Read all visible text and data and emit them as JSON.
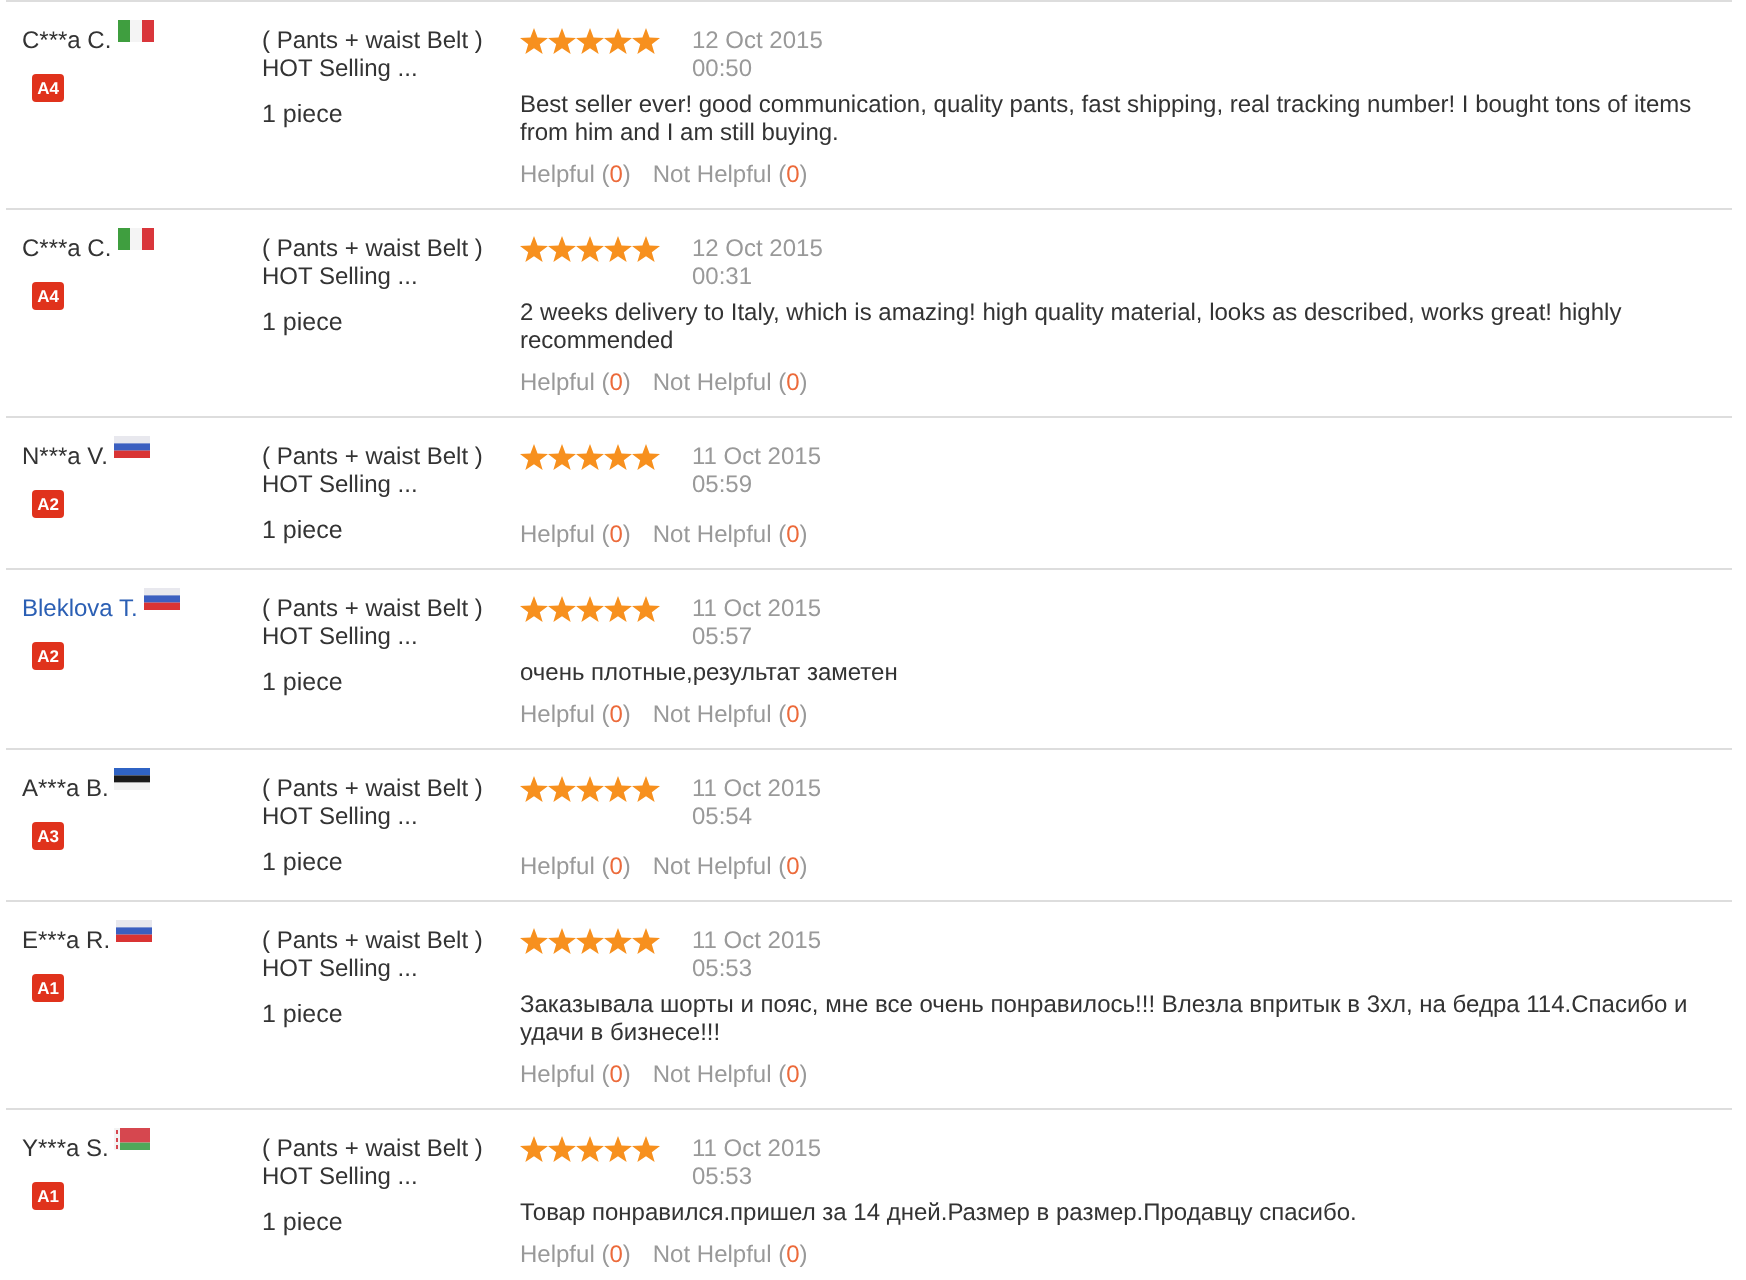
{
  "reviews": [
    {
      "reviewer": {
        "name": "C***a C.",
        "linked": false
      },
      "flag": {
        "kind": "italy"
      },
      "badge": "A4",
      "product": "( Pants + waist Belt ) HOT Selling ...",
      "quantity": "1 piece",
      "stars": 5,
      "date": "12 Oct 2015",
      "time": "00:50",
      "comment": "Best seller ever! good communication, quality pants, fast shipping, real tracking number! I bought tons of items from him and I am still buying.",
      "helpful": {
        "label": "Helpful",
        "open": "(",
        "count": "0",
        "close": ")"
      },
      "not_helpful": {
        "label": "Not Helpful",
        "open": "(",
        "count": "0",
        "close": ")"
      }
    },
    {
      "reviewer": {
        "name": "C***a C.",
        "linked": false
      },
      "flag": {
        "kind": "italy"
      },
      "badge": "A4",
      "product": "( Pants + waist Belt ) HOT Selling ...",
      "quantity": "1 piece",
      "stars": 5,
      "date": "12 Oct 2015",
      "time": "00:31",
      "comment": "2 weeks delivery to Italy, which is amazing! high quality material, looks as described, works great! highly recommended",
      "helpful": {
        "label": "Helpful",
        "open": "(",
        "count": "0",
        "close": ")"
      },
      "not_helpful": {
        "label": "Not Helpful",
        "open": "(",
        "count": "0",
        "close": ")"
      }
    },
    {
      "reviewer": {
        "name": "N***a V.",
        "linked": false
      },
      "flag": {
        "kind": "russia"
      },
      "badge": "A2",
      "product": "( Pants + waist Belt ) HOT Selling ...",
      "quantity": "1 piece",
      "stars": 5,
      "date": "11 Oct 2015",
      "time": "05:59",
      "helpful": {
        "label": "Helpful",
        "open": "(",
        "count": "0",
        "close": ")"
      },
      "not_helpful": {
        "label": "Not Helpful",
        "open": "(",
        "count": "0",
        "close": ")"
      }
    },
    {
      "reviewer": {
        "name": "Bleklova T.",
        "linked": true
      },
      "flag": {
        "kind": "russia"
      },
      "badge": "A2",
      "product": "( Pants + waist Belt ) HOT Selling ...",
      "quantity": "1 piece",
      "stars": 5,
      "date": "11 Oct 2015",
      "time": "05:57",
      "comment": "очень плотные,результат заметен",
      "helpful": {
        "label": "Helpful",
        "open": "(",
        "count": "0",
        "close": ")"
      },
      "not_helpful": {
        "label": "Not Helpful",
        "open": "(",
        "count": "0",
        "close": ")"
      }
    },
    {
      "reviewer": {
        "name": "A***a B.",
        "linked": false
      },
      "flag": {
        "kind": "estonia"
      },
      "badge": "A3",
      "product": "( Pants + waist Belt ) HOT Selling ...",
      "quantity": "1 piece",
      "stars": 5,
      "date": "11 Oct 2015",
      "time": "05:54",
      "helpful": {
        "label": "Helpful",
        "open": "(",
        "count": "0",
        "close": ")"
      },
      "not_helpful": {
        "label": "Not Helpful",
        "open": "(",
        "count": "0",
        "close": ")"
      }
    },
    {
      "reviewer": {
        "name": "E***a R.",
        "linked": false
      },
      "flag": {
        "kind": "russia"
      },
      "badge": "A1",
      "product": "( Pants + waist Belt ) HOT Selling ...",
      "quantity": "1 piece",
      "stars": 5,
      "date": "11 Oct 2015",
      "time": "05:53",
      "comment": "Заказывала шорты и пояс, мне все очень понравилось!!! Влезла впритык в 3хл, на бедра 114.Спасибо и удачи в бизнесе!!!",
      "helpful": {
        "label": "Helpful",
        "open": "(",
        "count": "0",
        "close": ")"
      },
      "not_helpful": {
        "label": "Not Helpful",
        "open": "(",
        "count": "0",
        "close": ")"
      }
    },
    {
      "reviewer": {
        "name": "Y***a S.",
        "linked": false
      },
      "flag": {
        "kind": "belarus"
      },
      "badge": "A1",
      "product": "( Pants + waist Belt ) HOT Selling ...",
      "quantity": "1 piece",
      "stars": 5,
      "date": "11 Oct 2015",
      "time": "05:53",
      "comment": "Товар понравился.пришел за 14 дней.Размер в размер.Продавцу спасибо.",
      "helpful": {
        "label": "Helpful",
        "open": "(",
        "count": "0",
        "close": ")"
      },
      "not_helpful": {
        "label": "Not Helpful",
        "open": "(",
        "count": "0",
        "close": ")"
      }
    }
  ]
}
